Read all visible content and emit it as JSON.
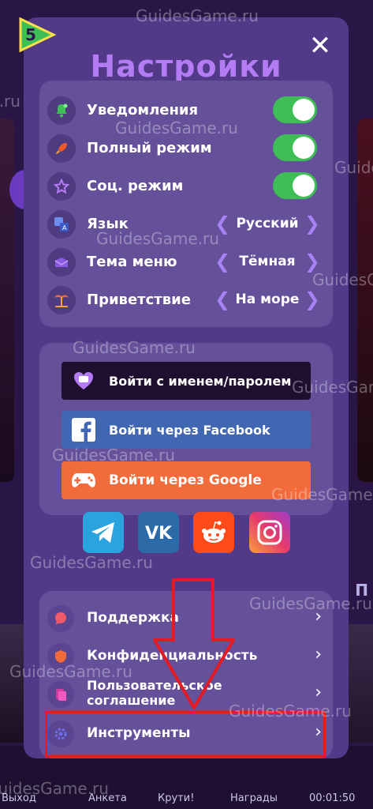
{
  "level": "5",
  "title": "Настройки",
  "close_symbol": "✕",
  "settings": {
    "rows": [
      {
        "label": "Уведомления",
        "icon": "bell-icon",
        "type": "toggle",
        "on": true
      },
      {
        "label": "Полный режим",
        "icon": "rocket-icon",
        "type": "toggle",
        "on": true
      },
      {
        "label": "Соц. режим",
        "icon": "star-icon",
        "type": "toggle",
        "on": true
      },
      {
        "label": "Язык",
        "icon": "translate-icon",
        "type": "select",
        "value": "Русский"
      },
      {
        "label": "Тема меню",
        "icon": "envelope-icon",
        "type": "select",
        "value": "Тёмная"
      },
      {
        "label": "Приветствие",
        "icon": "palm-icon",
        "type": "select",
        "value": "На море"
      }
    ],
    "arrow_left": "❮",
    "arrow_right": "❯"
  },
  "login": {
    "password": "Войти с именем/паролем",
    "facebook": "Войти через Facebook",
    "google": "Войти через Google"
  },
  "social_icons": [
    "telegram-icon",
    "vk-icon",
    "reddit-icon",
    "instagram-icon"
  ],
  "menu": {
    "items": [
      {
        "label": "Поддержка"
      },
      {
        "label": "Конфиденциальность"
      },
      {
        "label": "Пользовательское соглашение"
      },
      {
        "label": "Инструменты"
      }
    ],
    "chevron": "›"
  },
  "bottom_bar": [
    "Выход",
    "Анкета",
    "Крути!",
    "Награды",
    "00:01:50"
  ],
  "background_partial_text": "П",
  "watermark": "GuidesGame.ru",
  "colors": {
    "modal": "#523a88",
    "panel": "#65509a",
    "title": "#b37cf5",
    "toggle_on": "#3dbf56",
    "facebook": "#4267b2",
    "google": "#f26b3a",
    "highlight": "#e21b24"
  }
}
